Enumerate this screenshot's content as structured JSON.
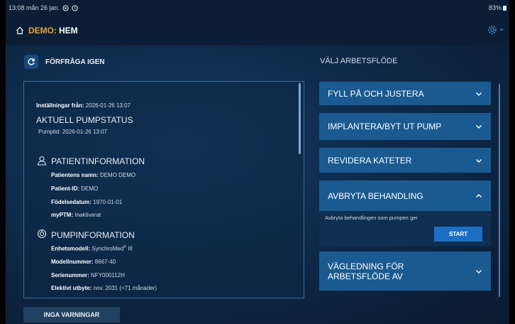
{
  "status_bar": {
    "time_date": "13:08  mån 26 jan.",
    "battery": "83%"
  },
  "header": {
    "demo_label": "DEMO",
    "separator": ":",
    "page_title": "HEM"
  },
  "refresh": {
    "label": "FÖRFRÅGA IGEN"
  },
  "pump_status": {
    "settings_from_label": "Inställningar från:",
    "settings_from_value": "2026-01-26  13:07",
    "heading": "AKTUELL PUMPSTATUS",
    "pump_time_label": "Pumptid:",
    "pump_time_value": "2026-01-26 13:07"
  },
  "patient_info": {
    "heading": "PATIENTINFORMATION",
    "name_label": "Patientens namn:",
    "name_value": "DEMO DEMO",
    "id_label": "Patient-ID:",
    "id_value": "DEMO",
    "dob_label": "Födelsedatum:",
    "dob_value": "1970-01-01",
    "myptm_label": "myPTM:",
    "myptm_value": "Inaktiverat"
  },
  "pump_info": {
    "heading": "PUMPINFORMATION",
    "model_label": "Enhetsmodell:",
    "model_value": "SynchroMed",
    "model_suffix": "III",
    "model_number_label": "Modellnummer:",
    "model_number_value": "8667-40",
    "serial_label": "Serienummer:",
    "serial_value": "NFY000112H",
    "elective_label": "Elektivt utbyte:",
    "elective_value": "nov. 2031 (<71 månader)"
  },
  "alerts_button": {
    "label": "INGA VARNINGAR"
  },
  "workflow": {
    "title": "VÄLJ ARBETSFLÖDE",
    "items": [
      {
        "label": "FYLL PÅ OCH JUSTERA",
        "expanded": false
      },
      {
        "label": "IMPLANTERA/BYT UT PUMP",
        "expanded": false
      },
      {
        "label": "REVIDERA KATETER",
        "expanded": false
      },
      {
        "label": "AVBRYTA BEHANDLING",
        "expanded": true,
        "description": "Avbryta behandlingen som pumpen ger",
        "start_label": "START"
      },
      {
        "label_line1": "VÄGLEDNING FÖR",
        "label_line2": "ARBETSFLÖDE AV",
        "expanded": false
      }
    ]
  },
  "colors": {
    "accent_orange": "#e0a43c",
    "workflow_item": "#1a5a90",
    "start_button": "#1d6fc4"
  }
}
